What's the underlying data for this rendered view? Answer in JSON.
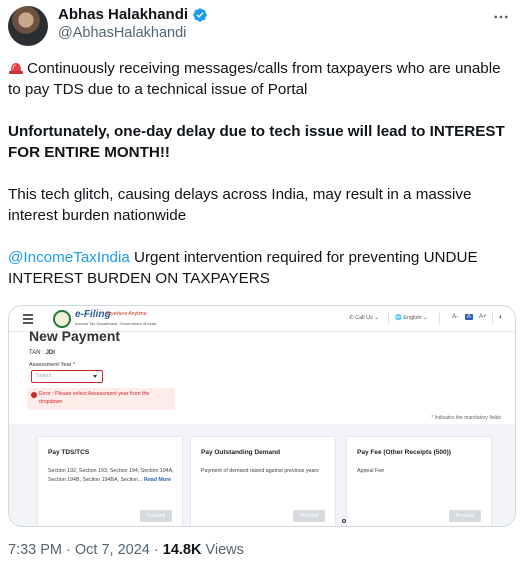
{
  "author": {
    "name": "Abhas Halakhandi",
    "handle": "@AbhasHalakhandi",
    "verified": true,
    "accent_color": "#1d9bf0"
  },
  "icons": {
    "more": "more-options-icon",
    "verified": "verified-badge-icon",
    "siren": "police-light-emoji-icon"
  },
  "tweet": {
    "para1": "Continuously receiving messages/calls from taxpayers who are unable to pay TDS due to a technical issue of Portal",
    "para2": "Unfortunately, one-day delay due to tech issue will lead to INTEREST FOR ENTIRE MONTH!!",
    "para3": "This tech glitch, causing delays across India, may result in a massive interest burden nationwide",
    "mention": "@IncomeTaxIndia",
    "para4_rest": " Urgent intervention required for preventing UNDUE INTEREST BURDEN ON TAXPAYERS"
  },
  "screenshot": {
    "logo_text": "e-Filing",
    "logo_tagline": "Anywhere Anytime",
    "logo_sub": "Income Tax Department, Government of India",
    "call_us": "Call Us",
    "language": "English",
    "font_controls": [
      "A-",
      "A",
      "A+"
    ],
    "page_title": "New Payment",
    "tan_label": "TAN :",
    "tan_value": "JDI",
    "assessment_year_label": "Assessment Year",
    "required_marker": "*",
    "select_placeholder": "Select",
    "error_message": "Error : Please select Assessment year from the dropdown",
    "mandatory_note": "* Indicates the mandatory fields",
    "cards": [
      {
        "title": "Pay TDS/TCS",
        "description": "Section 192, Section 193, Section 194, Section 194A, Section 194B, Section 194BA, Section...",
        "link": "Read More",
        "button": "Proceed"
      },
      {
        "title": "Pay Outstanding Demand",
        "description": "Payment of demand raised against previous years",
        "link": "",
        "button": "Proceed"
      },
      {
        "title": "Pay Fee (Other Receipts (500))",
        "description": "Appeal Fee",
        "link": "",
        "button": "Proceed"
      }
    ]
  },
  "meta": {
    "time": "7:33 PM",
    "separator": " · ",
    "date": "Oct 7, 2024",
    "views_count": "14.8K",
    "views_label": " Views"
  }
}
